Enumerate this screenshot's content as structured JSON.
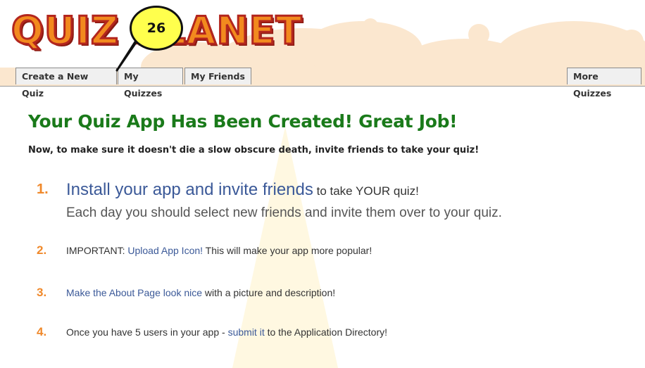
{
  "header": {
    "logo_text": "QUIZ PLANET",
    "callout_number": "26"
  },
  "nav": {
    "tabs": [
      {
        "label": "Create a New Quiz"
      },
      {
        "label": "My Quizzes"
      },
      {
        "label": "My Friends"
      }
    ],
    "right_tab": {
      "label": "More Quizzes"
    }
  },
  "main": {
    "title": "Your Quiz App Has Been Created! Great Job!",
    "subtitle": "Now, to make sure it doesn't die a slow obscure death, invite friends to take your quiz!",
    "steps": [
      {
        "number": "1.",
        "link": "Install your app and invite friends",
        "text": " to take YOUR quiz!",
        "detail": "Each day you should select new friends and invite them over to your quiz."
      },
      {
        "number": "2.",
        "prefix": "IMPORTANT: ",
        "link": "Upload App Icon!",
        "text": " This will make your app more popular!"
      },
      {
        "number": "3.",
        "link": "Make the About Page look nice",
        "text": " with a picture and description!"
      },
      {
        "number": "4.",
        "prefix": "Once you have 5 users in your app - ",
        "link": "submit it",
        "text": " to the Application Directory!"
      }
    ]
  },
  "colors": {
    "title_green": "#1a7a1a",
    "link_blue": "#3b5998",
    "number_orange": "#f0892b",
    "header_peach": "#fbe7cf",
    "callout_yellow": "#ffff4d"
  }
}
